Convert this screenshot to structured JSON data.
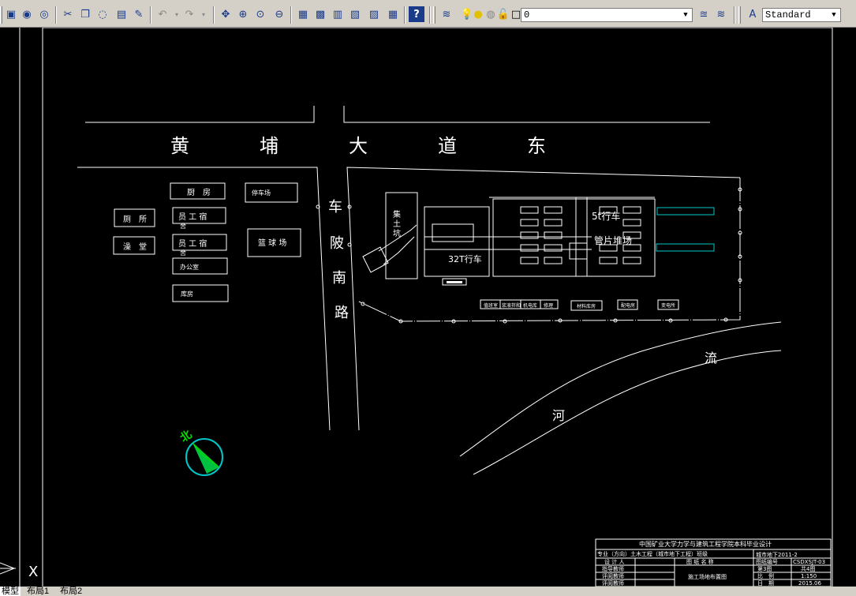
{
  "toolbar": {
    "icons": [
      "print-preview-icon",
      "publish-icon",
      "web-icon",
      "cut-icon",
      "copy-icon",
      "match-properties-icon",
      "brush-icon",
      "undo-icon",
      "redo-icon",
      "pan-icon",
      "zoom-realtime-icon",
      "zoom-window-icon",
      "zoom-previous-icon",
      "properties-icon",
      "design-center-icon",
      "tool-palettes-icon",
      "sheet-set-icon",
      "markup-icon",
      "calculator-icon",
      "help-icon"
    ],
    "layer_value": "0",
    "textstyle_value": "Standard"
  },
  "drawing": {
    "road_main_chars": [
      "黄",
      "埔",
      "大",
      "道",
      "东"
    ],
    "road_side_chars": [
      "车",
      "陂",
      "南",
      "路"
    ],
    "river_chars": [
      "流",
      "河"
    ],
    "buildings_left": {
      "kitchen": "厨　房",
      "parking": "停车场",
      "toilet": "厕　所",
      "staff_dorm_1": "员 工 宿",
      "staff_dorm_1b": "舍",
      "bathroom": "澡　堂",
      "staff_dorm_2": "员 工 宿",
      "staff_dorm_2b": "舍",
      "basketball": "篮 球 场",
      "office": "办公室",
      "warehouse": "库房"
    },
    "site": {
      "pit": [
        "集",
        "土",
        "坑"
      ],
      "crane_5t": "5t行车",
      "segment_yard": "管片堆场",
      "crane_32t": "32T行车",
      "bottom_labels": [
        "值班室",
        "浆液拌和",
        "机电库",
        "修理",
        "材料库房",
        "配电房",
        "变电所"
      ]
    },
    "north_arrow_label": "北"
  },
  "title_block": {
    "school": "中国矿业大学力学与建筑工程学院本科毕业设计",
    "major": "专业（方向）土木工程（城市地下工程）班级",
    "class_no": "城市地下2011-2",
    "drawing_no_label": "图纸编号",
    "drawing_no": "CSDXSJT-03",
    "designer": "设 计 人",
    "drawing_name_label": "图 纸 名 称",
    "supervisor": "指导教师",
    "reviewer": "评阅教师",
    "examiner": "评阅教师",
    "drawing_name": "施工场地布置图",
    "sheet_label": "第3图",
    "total_sheets": "共4图",
    "scale_label": "比　例",
    "scale_value": "1:150",
    "date_label": "日　期",
    "date_value": "2015.06"
  },
  "tabs": [
    "模型",
    "布局1",
    "布局2"
  ],
  "colors": {
    "cad_bg": "#000000",
    "line": "#ffffff",
    "cyan": "#00c8c8",
    "green": "#00e000"
  }
}
